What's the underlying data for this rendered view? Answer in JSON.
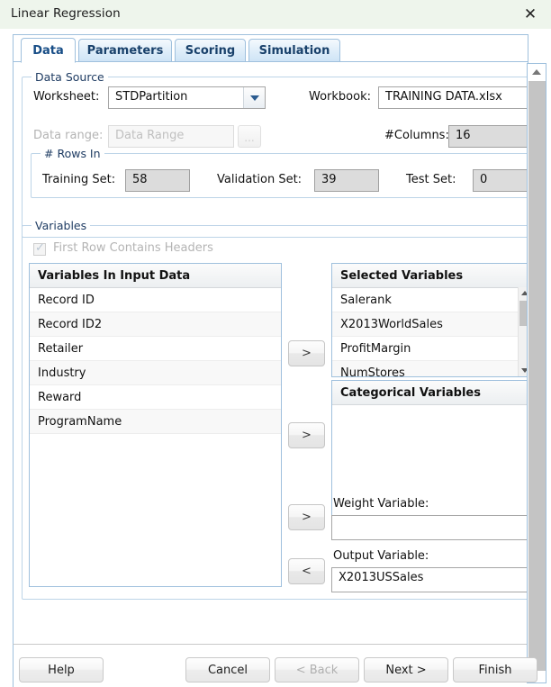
{
  "window": {
    "title": "Linear Regression",
    "close_icon": "close-icon"
  },
  "tabs": [
    {
      "label": "Data",
      "active": true
    },
    {
      "label": "Parameters",
      "active": false
    },
    {
      "label": "Scoring",
      "active": false
    },
    {
      "label": "Simulation",
      "active": false
    }
  ],
  "data_source": {
    "group_label": "Data Source",
    "worksheet_label": "Worksheet:",
    "worksheet_value": "STDPartition",
    "workbook_label": "Workbook:",
    "workbook_value": "TRAINING DATA.xlsx",
    "data_range_label": "Data range:",
    "data_range_placeholder": "Data Range",
    "browse_label": "...",
    "columns_label": "#Columns:",
    "columns_value": "16",
    "rows_in": {
      "group_label": "# Rows In",
      "training_label": "Training Set:",
      "training_value": "58",
      "validation_label": "Validation Set:",
      "validation_value": "39",
      "test_label": "Test Set:",
      "test_value": "0"
    }
  },
  "variables": {
    "group_label": "Variables",
    "first_row_headers_label": "First Row Contains Headers",
    "first_row_headers_checked": true,
    "input_list": {
      "header": "Variables In Input Data",
      "items": [
        "Record ID",
        "Record ID2",
        "Retailer",
        "Industry",
        "Reward",
        "ProgramName"
      ]
    },
    "selected_list": {
      "header": "Selected Variables",
      "items": [
        "Salerank",
        "X2013WorldSales",
        "ProfitMargin",
        "NumStores"
      ]
    },
    "categorical_list": {
      "header": "Categorical Variables",
      "items": []
    },
    "weight_variable_label": "Weight Variable:",
    "weight_variable_value": "",
    "output_variable_label": "Output Variable:",
    "output_variable_value": "X2013USSales",
    "transfer_buttons": [
      {
        "label": ">",
        "name": "add-selected-variable-button"
      },
      {
        "label": ">",
        "name": "add-categorical-variable-button"
      },
      {
        "label": ">",
        "name": "add-weight-variable-button"
      },
      {
        "label": "<",
        "name": "remove-output-variable-button"
      }
    ]
  },
  "footer": {
    "help": "Help",
    "cancel": "Cancel",
    "back": "< Back",
    "next": "Next >",
    "finish": "Finish"
  }
}
